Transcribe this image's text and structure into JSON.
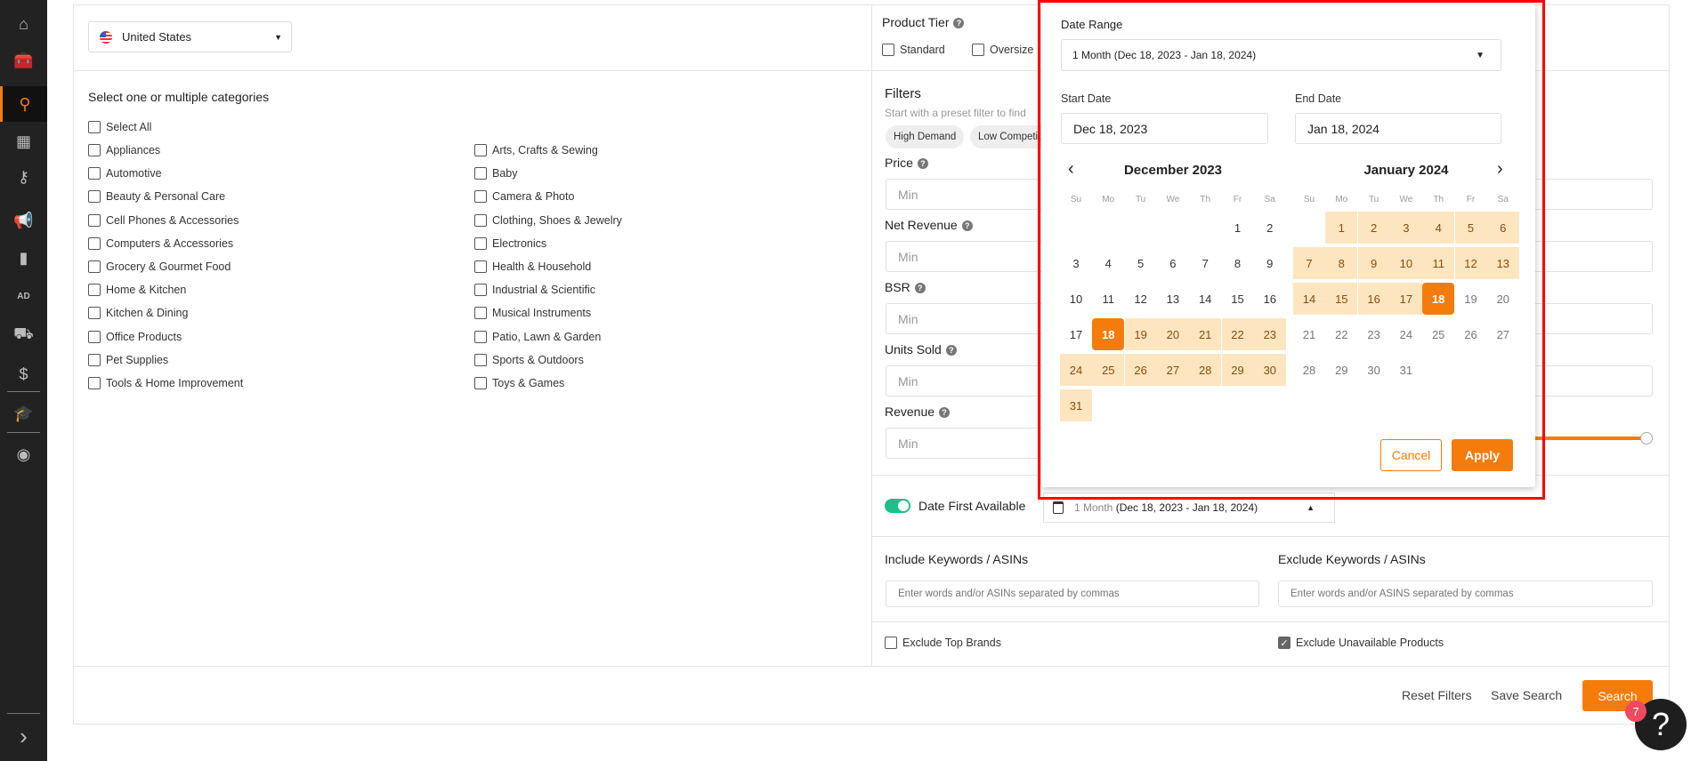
{
  "sidebar": {
    "items": [
      {
        "icon": "home-icon",
        "glyph": "⌂"
      },
      {
        "icon": "toolbox-icon",
        "glyph": "🧰"
      },
      {
        "icon": "product-research-icon",
        "glyph": "⚲",
        "active": true
      },
      {
        "icon": "warehouse-icon",
        "glyph": "▦"
      },
      {
        "icon": "key-icon",
        "glyph": "⚷"
      },
      {
        "icon": "megaphone-icon",
        "glyph": "📢"
      },
      {
        "icon": "bar-chart-icon",
        "glyph": "▮"
      },
      {
        "icon": "ad-icon",
        "glyph": "AD"
      },
      {
        "icon": "hand-box-icon",
        "glyph": "⛟"
      },
      {
        "icon": "money-cycle-icon",
        "glyph": "$"
      },
      {
        "icon": "graduation-cap-icon",
        "glyph": "🎓"
      },
      {
        "icon": "chrome-icon",
        "glyph": "◉"
      }
    ],
    "expand_icon": "chevron-right-icon",
    "expand_glyph": "›"
  },
  "marketplace": {
    "value": "United States"
  },
  "categories": {
    "title": "Select one or multiple categories",
    "select_all": "Select All",
    "col1": [
      "Appliances",
      "Automotive",
      "Beauty & Personal Care",
      "Cell Phones & Accessories",
      "Computers & Accessories",
      "Grocery & Gourmet Food",
      "Home & Kitchen",
      "Kitchen & Dining",
      "Office Products",
      "Pet Supplies",
      "Tools & Home Improvement"
    ],
    "col2": [
      "Arts, Crafts & Sewing",
      "Baby",
      "Camera & Photo",
      "Clothing, Shoes & Jewelry",
      "Electronics",
      "Health & Household",
      "Industrial & Scientific",
      "Musical Instruments",
      "Patio, Lawn & Garden",
      "Sports & Outdoors",
      "Toys & Games"
    ]
  },
  "product_tier": {
    "label": "Product Tier",
    "options": [
      "Standard",
      "Oversize"
    ]
  },
  "filters": {
    "title": "Filters",
    "subtitle": "Start with a preset filter to find",
    "presets": [
      "High Demand",
      "Low Competition"
    ],
    "fields": [
      {
        "label": "Price",
        "placeholder": "Min"
      },
      {
        "label": "Net Revenue",
        "placeholder": "Min"
      },
      {
        "label": "BSR",
        "placeholder": "Min"
      },
      {
        "label": "Units Sold",
        "placeholder": "Min"
      },
      {
        "label": "Revenue",
        "placeholder": "Min"
      }
    ]
  },
  "date_first_available": {
    "label": "Date First Available",
    "enabled": true,
    "range_label": "1 Month",
    "range_dates": "(Dec 18, 2023 - Jan 18, 2024)"
  },
  "keywords": {
    "include_label": "Include Keywords / ASINs",
    "include_placeholder": "Enter words and/or ASINs separated by commas",
    "exclude_label": "Exclude Keywords / ASINs",
    "exclude_placeholder": "Enter words and/or ASINS separated by commas"
  },
  "options": {
    "exclude_top_brands": {
      "label": "Exclude Top Brands",
      "checked": false
    },
    "exclude_unavailable": {
      "label": "Exclude Unavailable Products",
      "checked": true
    }
  },
  "actions": {
    "reset": "Reset Filters",
    "save": "Save Search",
    "search": "Search"
  },
  "help": {
    "badge": "7",
    "glyph": "?"
  },
  "date_popup": {
    "range_label": "Date Range",
    "range_value": "1 Month (Dec 18, 2023 - Jan 18, 2024)",
    "start_label": "Start Date",
    "start_value": "Dec 18, 2023",
    "end_label": "End Date",
    "end_value": "Jan 18, 2024",
    "weekdays": [
      "Su",
      "Mo",
      "Tu",
      "We",
      "Th",
      "Fr",
      "Sa"
    ],
    "months": [
      {
        "title": "December 2023",
        "year": 2023,
        "month": 12
      },
      {
        "title": "January 2024",
        "year": 2024,
        "month": 1
      }
    ],
    "range": {
      "start": "2023-12-18",
      "end": "2024-01-18"
    },
    "cancel": "Cancel",
    "apply": "Apply"
  },
  "colors": {
    "accent": "#f57c0a",
    "range": "#fde6bf",
    "toggle": "#1dbf8a",
    "sidebar": "#222222"
  }
}
